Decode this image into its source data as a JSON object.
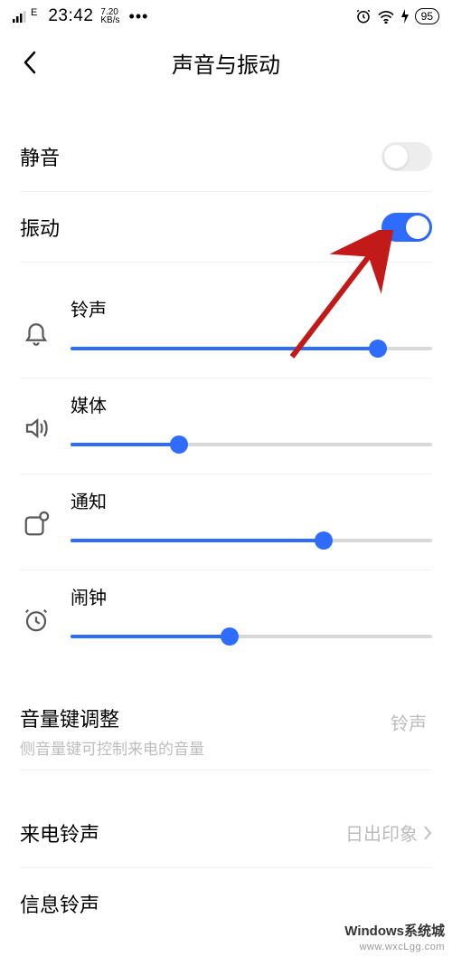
{
  "status": {
    "network": "E",
    "time": "23:42",
    "speed_top": "7.20",
    "speed_bottom": "KB/s",
    "battery": "95"
  },
  "header": {
    "title": "声音与振动"
  },
  "toggles": {
    "mute": {
      "label": "静音",
      "on": false
    },
    "vibrate": {
      "label": "振动",
      "on": true
    }
  },
  "sliders": {
    "ringtone": {
      "label": "铃声",
      "value": 85
    },
    "media": {
      "label": "媒体",
      "value": 30
    },
    "notify": {
      "label": "通知",
      "value": 70
    },
    "alarm": {
      "label": "闹钟",
      "value": 44
    }
  },
  "volkey": {
    "label": "音量键调整",
    "sub": "侧音量键可控制来电的音量",
    "value": "铃声"
  },
  "incoming_ringtone": {
    "label": "来电铃声",
    "value": "日出印象"
  },
  "message_ringtone": {
    "label": "信息铃声"
  },
  "watermark": {
    "line1": "Windows系统城",
    "line2": "www.wxcLgg.com"
  }
}
